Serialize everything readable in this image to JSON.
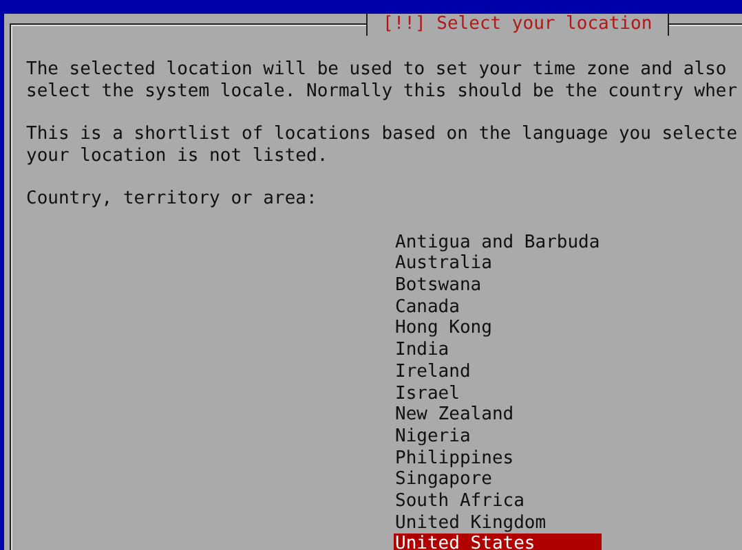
{
  "dialog": {
    "title": "[!!] Select your location",
    "paragraphs": [
      "The selected location will be used to set your time zone and also\nselect the system locale. Normally this should be the country wher",
      "This is a shortlist of locations based on the language you selecte\nyour location is not listed."
    ],
    "prompt": "Country, territory or area:",
    "options": [
      {
        "label": "Antigua and Barbuda",
        "selected": false
      },
      {
        "label": "Australia",
        "selected": false
      },
      {
        "label": "Botswana",
        "selected": false
      },
      {
        "label": "Canada",
        "selected": false
      },
      {
        "label": "Hong Kong",
        "selected": false
      },
      {
        "label": "India",
        "selected": false
      },
      {
        "label": "Ireland",
        "selected": false
      },
      {
        "label": "Israel",
        "selected": false
      },
      {
        "label": "New Zealand",
        "selected": false
      },
      {
        "label": "Nigeria",
        "selected": false
      },
      {
        "label": "Philippines",
        "selected": false
      },
      {
        "label": "Singapore",
        "selected": false
      },
      {
        "label": "South Africa",
        "selected": false
      },
      {
        "label": "United Kingdom",
        "selected": false
      },
      {
        "label": "United States",
        "selected": true
      }
    ]
  }
}
